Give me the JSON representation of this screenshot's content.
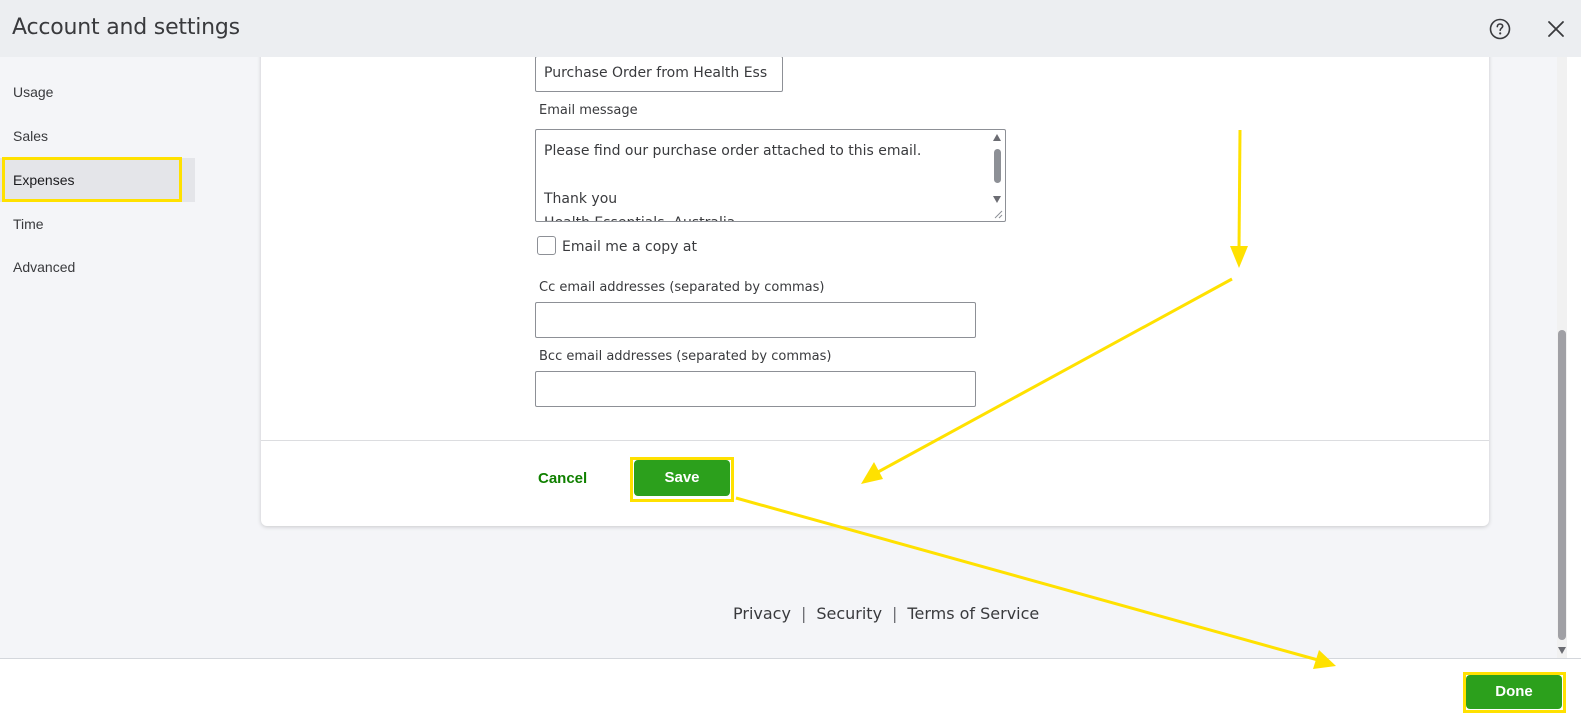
{
  "header": {
    "title": "Account and settings",
    "help_icon": "help-icon",
    "close_icon": "close-icon"
  },
  "sidebar": {
    "items": [
      {
        "label": "Usage"
      },
      {
        "label": "Sales"
      },
      {
        "label": "Expenses",
        "active": true
      },
      {
        "label": "Time"
      },
      {
        "label": "Advanced"
      }
    ]
  },
  "form": {
    "subject_value": "Purchase Order from Health Ess",
    "email_message_label": "Email message",
    "email_message_lines": [
      "Please find our purchase order attached to this email.",
      "",
      "Thank you",
      "Health Essentials, Australia"
    ],
    "email_copy_label": "Email me a copy at",
    "email_copy_checked": false,
    "cc_label": "Cc email addresses (separated by commas)",
    "cc_value": "",
    "bcc_label": "Bcc email addresses (separated by commas)",
    "bcc_value": "",
    "cancel_label": "Cancel",
    "save_label": "Save"
  },
  "footer": {
    "privacy": "Privacy",
    "separator": "|",
    "security": "Security",
    "terms": "Terms of Service"
  },
  "bottom_bar": {
    "done_label": "Done"
  },
  "colors": {
    "primary_green": "#2ca01c",
    "link_green": "#108000",
    "highlight": "#ffe100",
    "header_bg": "#eceef1",
    "sidebar_bg": "#f4f5f8"
  }
}
